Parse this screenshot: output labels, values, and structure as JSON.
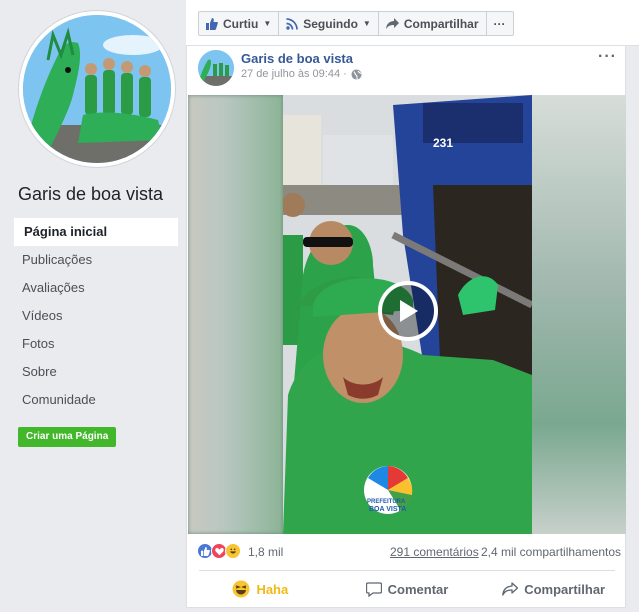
{
  "sidebar": {
    "page_name": "Garis de boa vista",
    "nav": [
      {
        "label": "Página inicial"
      },
      {
        "label": "Publicações"
      },
      {
        "label": "Avaliações"
      },
      {
        "label": "Vídeos"
      },
      {
        "label": "Fotos"
      },
      {
        "label": "Sobre"
      },
      {
        "label": "Comunidade"
      }
    ],
    "create_page_label": "Criar uma Página"
  },
  "topbar": {
    "liked_label": "Curtiu",
    "following_label": "Seguindo",
    "share_label": "Compartilhar",
    "more_label": "···"
  },
  "post": {
    "author": "Garis de boa vista",
    "date": "27 de julho às 09:44 ·",
    "menu_label": "···",
    "reaction_count": "1,8 mil",
    "comments": "291 comentários",
    "shares": "2,4 mil compartilhamentos",
    "actions": {
      "haha": "Haha",
      "comment": "Comentar",
      "share": "Compartilhar"
    },
    "video_labels": {
      "truck_number": "231",
      "logo_line1": "PREFEITURA",
      "logo_line2": "BOA VISTA"
    }
  },
  "colors": {
    "link": "#365899",
    "green_button": "#42b72a",
    "haha": "#f0ba15"
  }
}
